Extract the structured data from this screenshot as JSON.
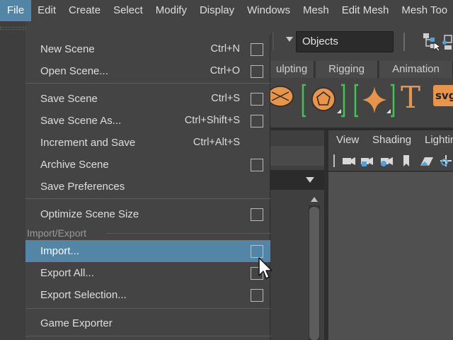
{
  "menubar": {
    "items": [
      "File",
      "Edit",
      "Create",
      "Select",
      "Modify",
      "Display",
      "Windows",
      "Mesh",
      "Edit Mesh",
      "Mesh Too"
    ],
    "active_index": 0
  },
  "toolbar": {
    "objects_field": "Objects"
  },
  "shelf": {
    "tabs": [
      "ulpting",
      "Rigging",
      "Animation"
    ],
    "icons": [
      "sphere-icon",
      "soccer-ball-icon",
      "sparkle-icon",
      "text-t-icon",
      "svg-icon"
    ],
    "svg_text": "svg",
    "text_glyph": "T",
    "accent_color": "#e8954b"
  },
  "viewport": {
    "menus": [
      "View",
      "Shading",
      "Lightin"
    ]
  },
  "file_menu": {
    "items": [
      {
        "label": "New Scene",
        "shortcut": "Ctrl+N",
        "option_box": true
      },
      {
        "label": "Open Scene...",
        "shortcut": "Ctrl+O",
        "option_box": true
      },
      {
        "label": "Save Scene",
        "shortcut": "Ctrl+S",
        "option_box": true
      },
      {
        "label": "Save Scene As...",
        "shortcut": "Ctrl+Shift+S",
        "option_box": true
      },
      {
        "label": "Increment and Save",
        "shortcut": "Ctrl+Alt+S",
        "option_box": false
      },
      {
        "label": "Archive Scene",
        "shortcut": "",
        "option_box": true
      },
      {
        "label": "Save Preferences",
        "shortcut": "",
        "option_box": false
      },
      {
        "label": "Optimize Scene Size",
        "shortcut": "",
        "option_box": true
      },
      {
        "label": "Import...",
        "shortcut": "",
        "option_box": true,
        "highlighted": true
      },
      {
        "label": "Export All...",
        "shortcut": "",
        "option_box": true
      },
      {
        "label": "Export Selection...",
        "shortcut": "",
        "option_box": true
      },
      {
        "label": "Game Exporter",
        "shortcut": "",
        "option_box": false
      }
    ],
    "section_import_export": "Import/Export",
    "highlight_color": "#5285a6"
  }
}
